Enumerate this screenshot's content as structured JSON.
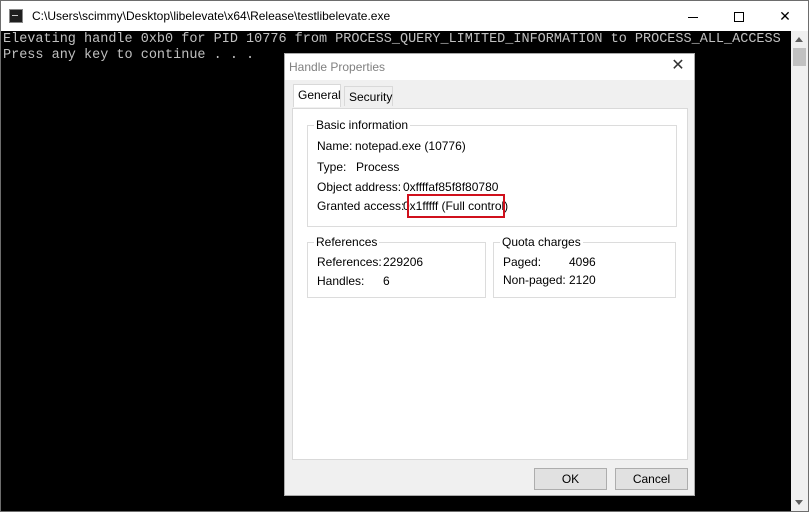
{
  "console": {
    "title": "C:\\Users\\scimmy\\Desktop\\libelevate\\x64\\Release\\testlibelevate.exe",
    "lines": [
      "Elevating handle 0xb0 for PID 10776 from PROCESS_QUERY_LIMITED_INFORMATION to PROCESS_ALL_ACCESS",
      "Press any key to continue . . ."
    ],
    "controls": {
      "minimize": "—",
      "maximize": "☐",
      "close": "✕"
    }
  },
  "dialog": {
    "title": "Handle Properties",
    "close": "✕",
    "tabs": [
      "General",
      "Security"
    ],
    "basic": {
      "label": "Basic information",
      "name_label": "Name:",
      "name_value": "notepad.exe (10776)",
      "type_label": "Type:",
      "type_value": "Process",
      "address_label": "Object address:",
      "address_value": "0xffffaf85f8f80780",
      "access_label": "Granted access:",
      "access_value": "0x1fffff (Full control)"
    },
    "references": {
      "label": "References",
      "refs_label": "References:",
      "refs_value": "229206",
      "handles_label": "Handles:",
      "handles_value": "6"
    },
    "quota": {
      "label": "Quota charges",
      "paged_label": "Paged:",
      "paged_value": "4096",
      "nonpaged_label": "Non-paged:",
      "nonpaged_value": "2120"
    },
    "buttons": {
      "ok": "OK",
      "cancel": "Cancel"
    }
  },
  "colors": {
    "highlight": "#d0101c",
    "console_bg": "#000000",
    "console_text": "#c0c0c0"
  }
}
